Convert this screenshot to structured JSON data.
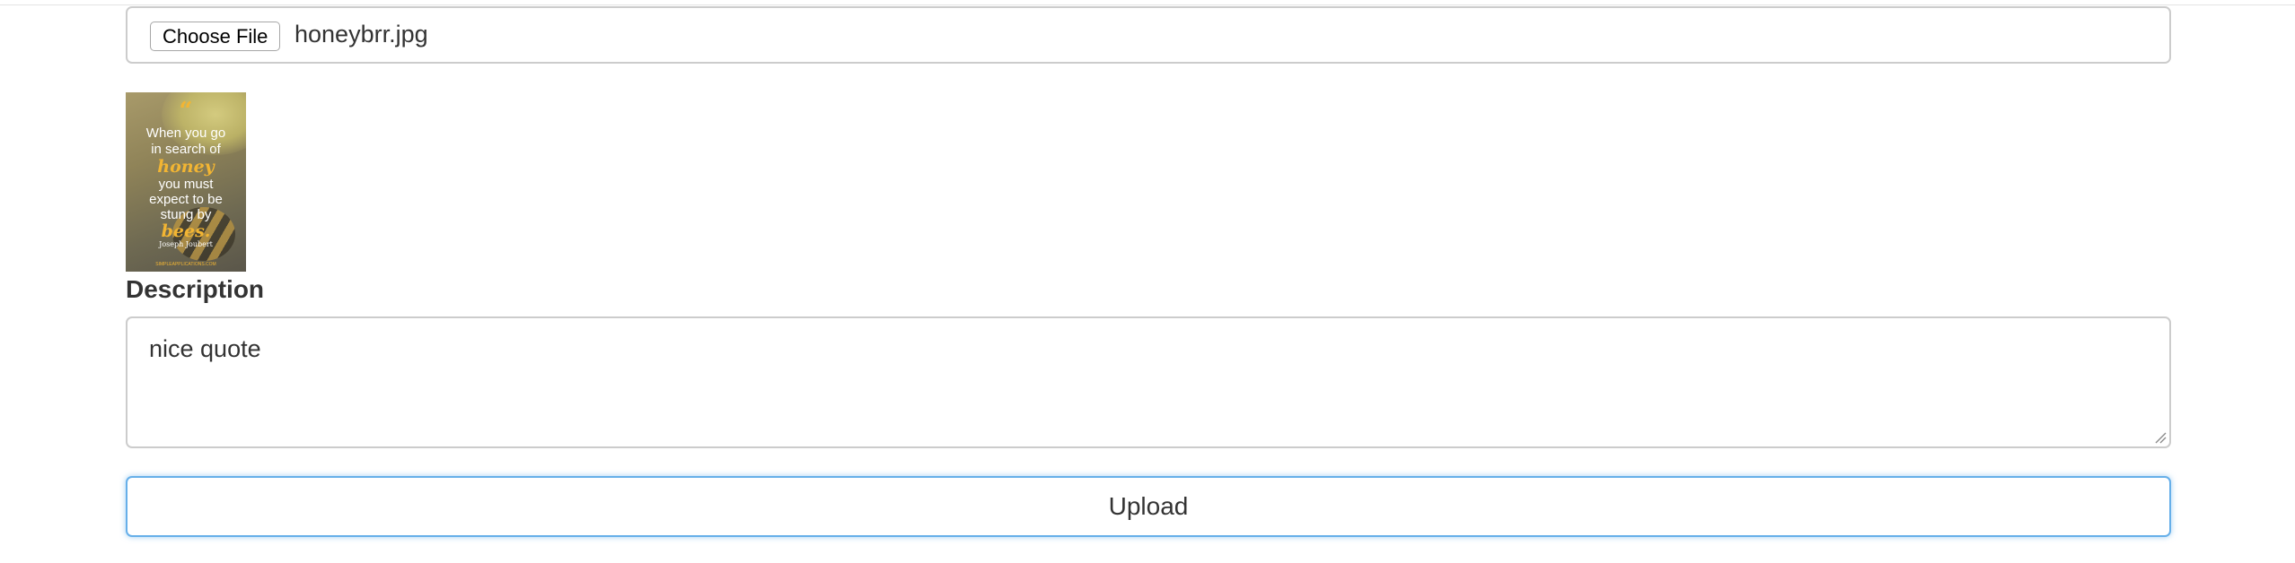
{
  "file_input": {
    "button_label": "Choose File",
    "selected_file": "honeybrr.jpg"
  },
  "preview": {
    "quote_mark": "“",
    "line1": "When you go",
    "line2": "in search of",
    "accent1": "honey",
    "line3": "you must",
    "line4": "expect to be",
    "line5": "stung by",
    "accent2": "bees.",
    "author": "Joseph Joubert",
    "site": "SIMPLEAPPLICATIONS.COM"
  },
  "description": {
    "label": "Description",
    "value": "nice quote"
  },
  "upload": {
    "label": "Upload"
  },
  "colors": {
    "focus_border": "#66afe9",
    "field_border": "#cccccc",
    "quote_accent": "#f2b533"
  }
}
